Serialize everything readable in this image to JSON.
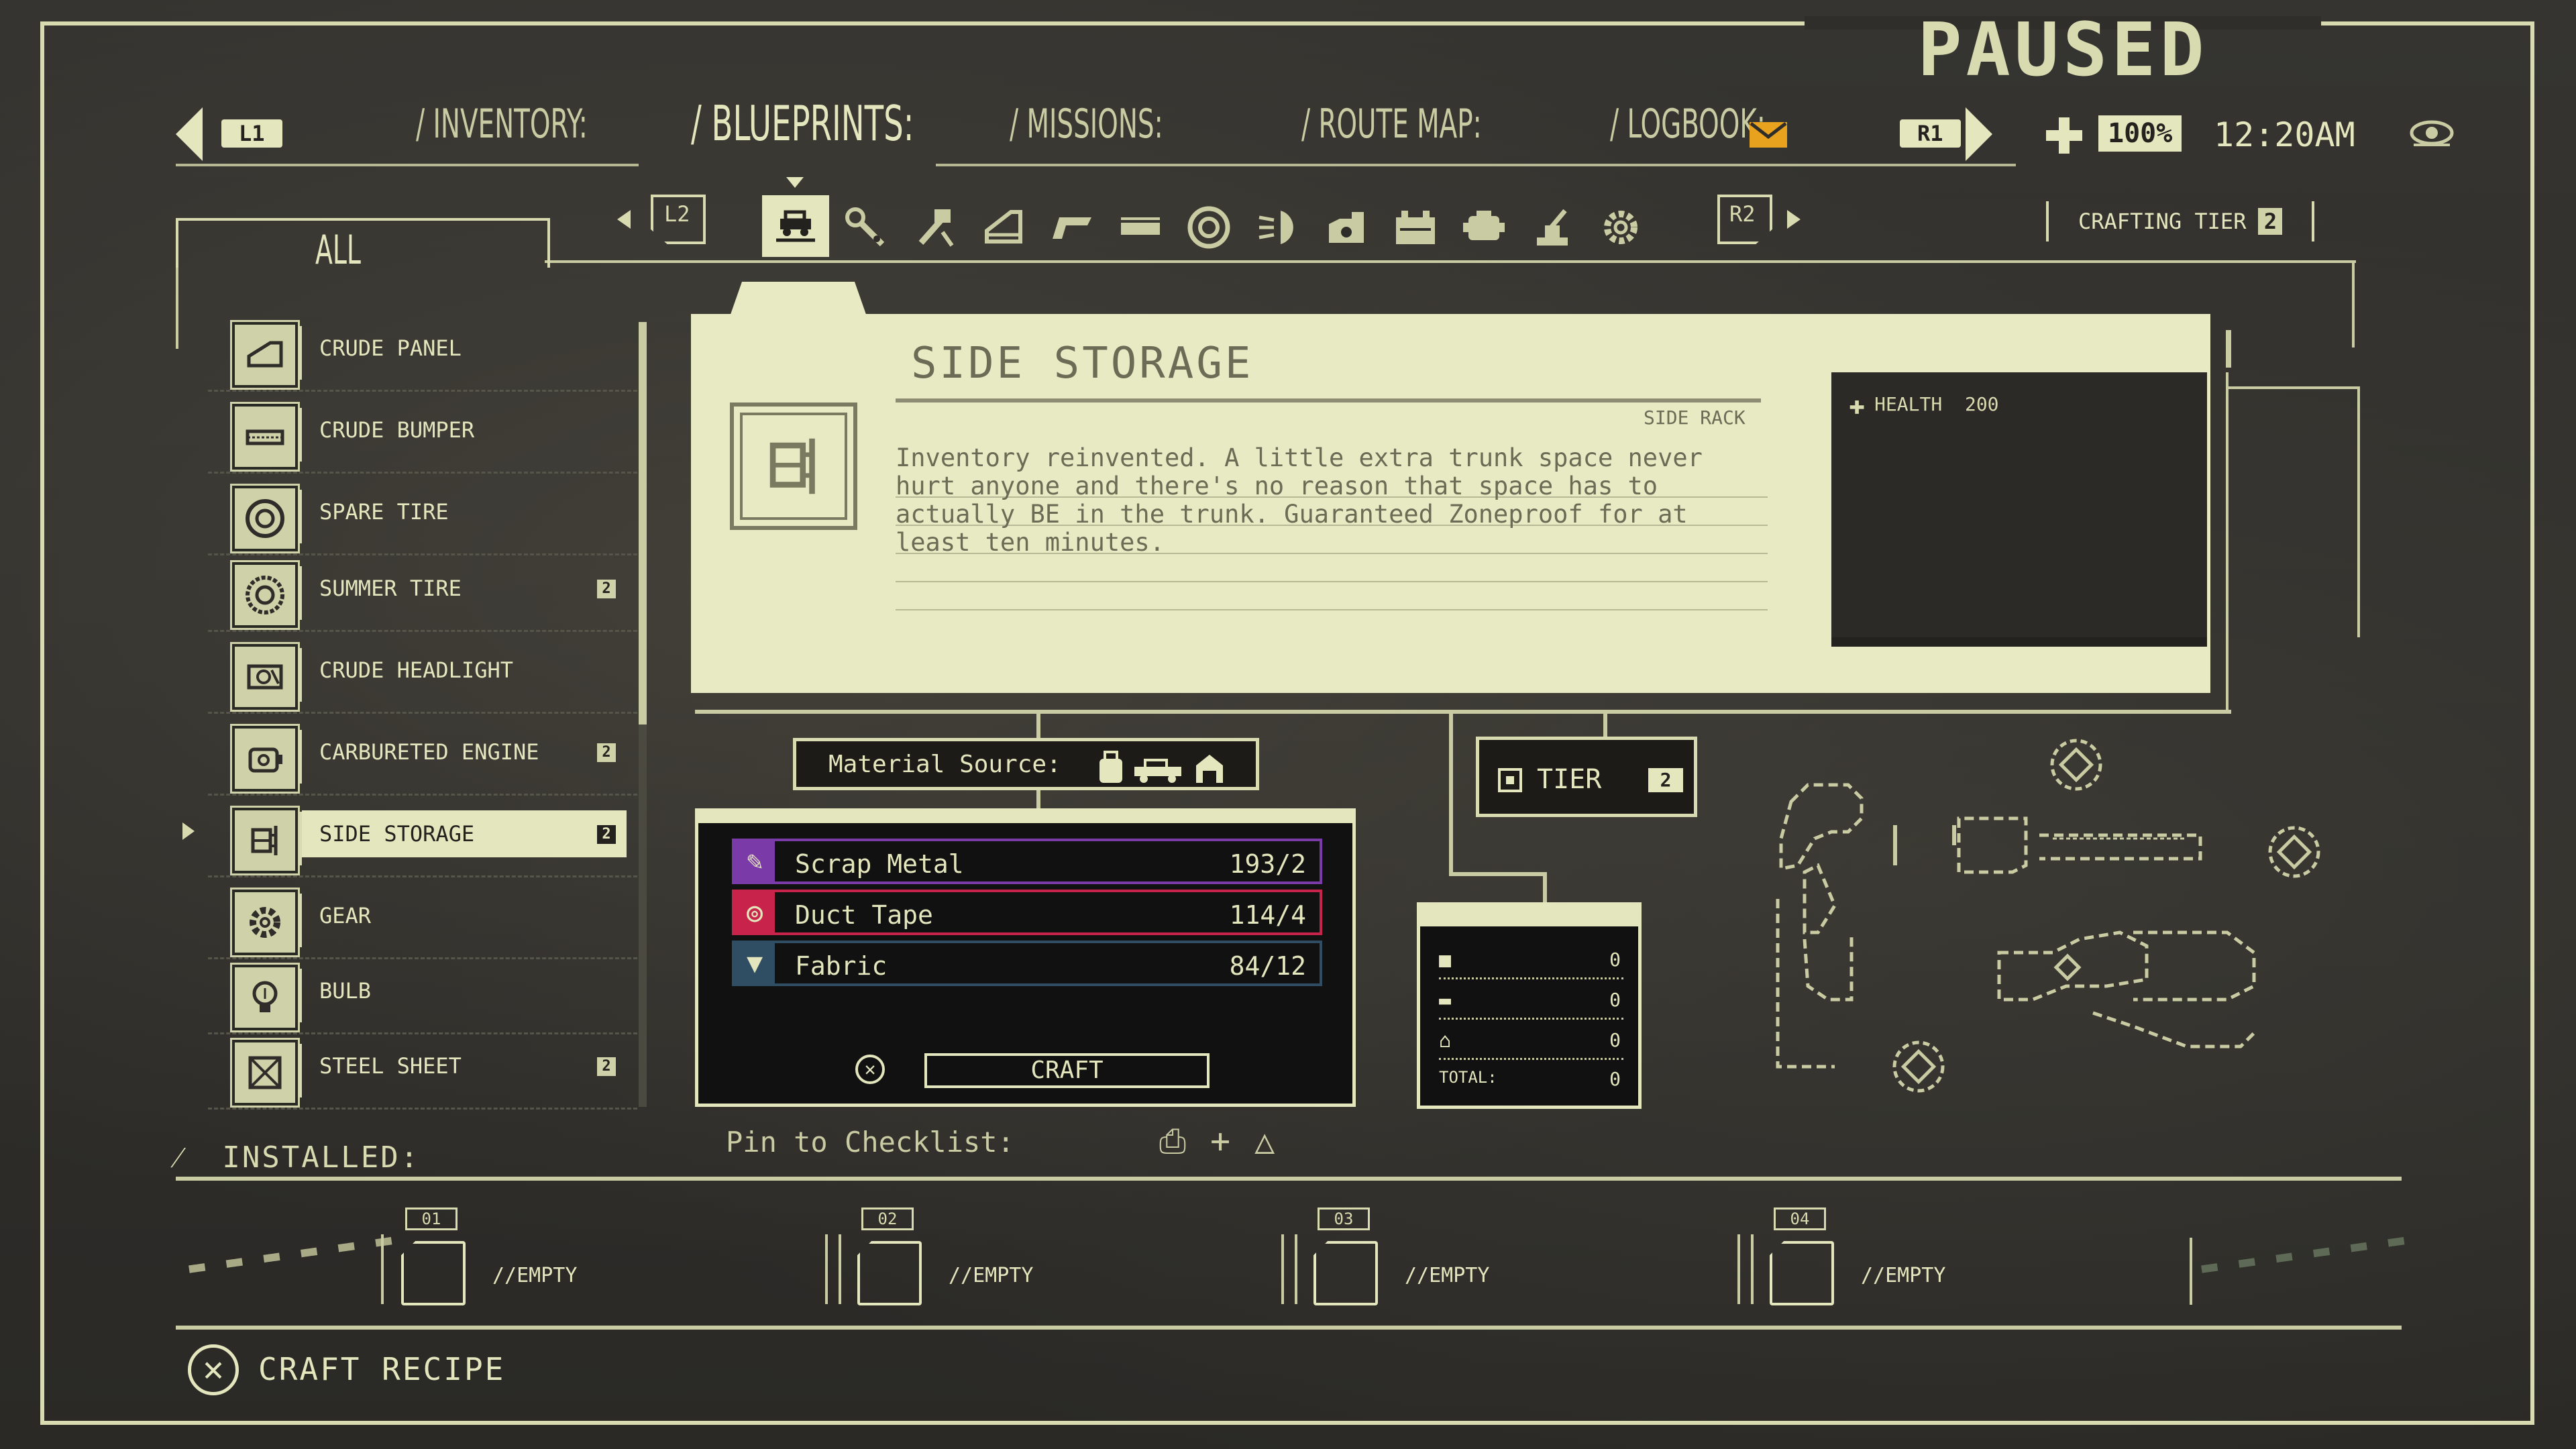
{
  "status": "PAUSED",
  "nav": {
    "left_button": "L1",
    "right_button": "R1",
    "tabs": [
      "/ INVENTORY:",
      "/ BLUEPRINTS:",
      "/ MISSIONS:",
      "/ ROUTE MAP:",
      "/ LOGBOOK:"
    ],
    "active_tab": "/ BLUEPRINTS:",
    "zoom": "100%",
    "time": "12:20AM"
  },
  "category_bar": {
    "left_button": "L2",
    "right_button": "R2",
    "crafting_tier_label": "CRAFTING TIER",
    "crafting_tier_value": "2",
    "categories": [
      "car-body-icon",
      "wrench-icon",
      "tools-icon",
      "panel-icon",
      "bumper-icon",
      "tray-icon",
      "tire-icon",
      "headlight-icon",
      "engine-icon",
      "battery-icon",
      "motor-icon",
      "turret-icon",
      "gear-icon"
    ]
  },
  "list": {
    "filter": "ALL",
    "items": [
      {
        "label": "CRUDE PANEL",
        "tier": ""
      },
      {
        "label": "CRUDE BUMPER",
        "tier": ""
      },
      {
        "label": "SPARE TIRE",
        "tier": ""
      },
      {
        "label": "SUMMER TIRE",
        "tier": "2"
      },
      {
        "label": "CRUDE HEADLIGHT",
        "tier": ""
      },
      {
        "label": "CARBURETED ENGINE",
        "tier": "2"
      },
      {
        "label": "SIDE STORAGE",
        "tier": "2"
      },
      {
        "label": "GEAR",
        "tier": ""
      },
      {
        "label": "BULB",
        "tier": ""
      },
      {
        "label": "STEEL SHEET",
        "tier": "2"
      }
    ],
    "selected_index": 6
  },
  "detail": {
    "title": "SIDE STORAGE",
    "subtitle": "SIDE RACK",
    "description": "Inventory reinvented. A little extra trunk space never\nhurt anyone and there's no reason that space has to\nactually BE in the trunk. Guaranteed Zoneproof for at\nleast ten minutes.",
    "stat_label": "HEALTH",
    "stat_value": "200"
  },
  "material_source_label": "Material Source:",
  "materials": [
    {
      "name": "Scrap Metal",
      "qty": "193/2",
      "color": "#7a3aa8"
    },
    {
      "name": "Duct Tape",
      "qty": "114/4",
      "color": "#c8234a"
    },
    {
      "name": "Fabric",
      "qty": "84/12",
      "color": "#2f4e63"
    }
  ],
  "craft_button": "CRAFT",
  "pin_label": "Pin to Checklist:",
  "tier_box": {
    "label": "TIER",
    "value": "2"
  },
  "totals": {
    "rows": [
      {
        "icon": "backpack-icon",
        "value": "0"
      },
      {
        "icon": "car-icon",
        "value": "0"
      },
      {
        "icon": "garage-icon",
        "value": "0"
      }
    ],
    "total_label": "TOTAL:",
    "total_value": "0"
  },
  "installed": {
    "label": "INSTALLED:",
    "slots": [
      {
        "num": "01",
        "label": "//EMPTY"
      },
      {
        "num": "02",
        "label": "//EMPTY"
      },
      {
        "num": "03",
        "label": "//EMPTY"
      },
      {
        "num": "04",
        "label": "//EMPTY"
      }
    ]
  },
  "footer": {
    "action": "CRAFT RECIPE"
  },
  "colors": {
    "accent": "#e4e6be",
    "panel": "#e8eac4",
    "background": "#2e2d29"
  }
}
